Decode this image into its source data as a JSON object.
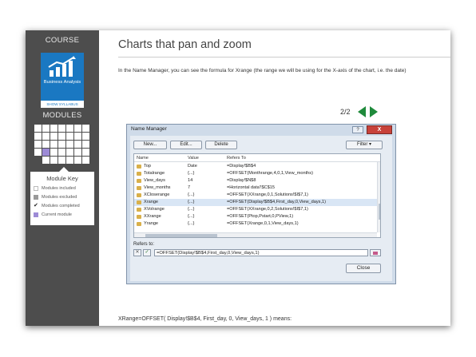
{
  "sidebar": {
    "course_label": "COURSE",
    "course_card": {
      "title": "Business Analysis",
      "icon": "bar-chart-growth-icon",
      "color": "#1a78c2"
    },
    "syllabus_link": "SHOW SYLLABUS",
    "modules_label": "MODULES",
    "module_key": {
      "title": "Module Key",
      "items": [
        {
          "label": "Modules included",
          "color": "#ffffff"
        },
        {
          "label": "Modules excluded",
          "color": "#9a9a9a"
        },
        {
          "label": "Modules completed",
          "icon": "checkmark-icon"
        },
        {
          "label": "Current module",
          "color": "#9d8bd6"
        }
      ]
    }
  },
  "main": {
    "title": "Charts that pan and zoom",
    "intro": "In the Name Manager, you can see the formula for Xrange (the range we will be using for the X-axis of the chart, i.e. the date)",
    "pager": {
      "count": "2/2",
      "prev_icon": "triangle-left-icon",
      "next_icon": "triangle-right-icon",
      "color": "#1f8a3b"
    },
    "formula_caption": "XRange=OFFSET( Display!$B$4, First_day, 0, View_days, 1 ) means:"
  },
  "name_manager": {
    "title": "Name Manager",
    "help": "?",
    "close_x": "X",
    "buttons": {
      "new": "New...",
      "edit": "Edit...",
      "delete": "Delete",
      "filter": "Filter ▾"
    },
    "columns": [
      "Name",
      "Value",
      "Refers To"
    ],
    "rows": [
      {
        "name": "Top",
        "value": "Date",
        "refers": "=Display!$B$4"
      },
      {
        "name": "Totalrange",
        "value": "{...}",
        "refers": "=OFFSET(Monthrange,4,0,1,View_months)"
      },
      {
        "name": "View_days",
        "value": "14",
        "refers": "=Display!$N$8"
      },
      {
        "name": "View_months",
        "value": "7",
        "refers": "=Horizontal data'!$C$15"
      },
      {
        "name": "XCloserange",
        "value": "{...}",
        "refers": "=OFFSET(XXrange,0,1,Solutions!$I$7,1)"
      },
      {
        "name": "Xrange",
        "value": "{...}",
        "refers": "=OFFSET(Display!$B$4,First_day,0,View_days,1)",
        "selected": true
      },
      {
        "name": "XVolrange",
        "value": "{...}",
        "refers": "=OFFSET(XXrange,0,2,Solutions!$I$7,1)"
      },
      {
        "name": "XXrange",
        "value": "{...}",
        "refers": "=OFFSET(Ptop,Pstart,0,PView,1)"
      },
      {
        "name": "Yrange",
        "value": "{...}",
        "refers": "=OFFSET(Xrange,0,1,View_days,1)"
      }
    ],
    "refers_label": "Refers to:",
    "refers_value": "=OFFSET(Display!$B$4,First_day,0,View_days,1)",
    "close_button": "Close"
  }
}
